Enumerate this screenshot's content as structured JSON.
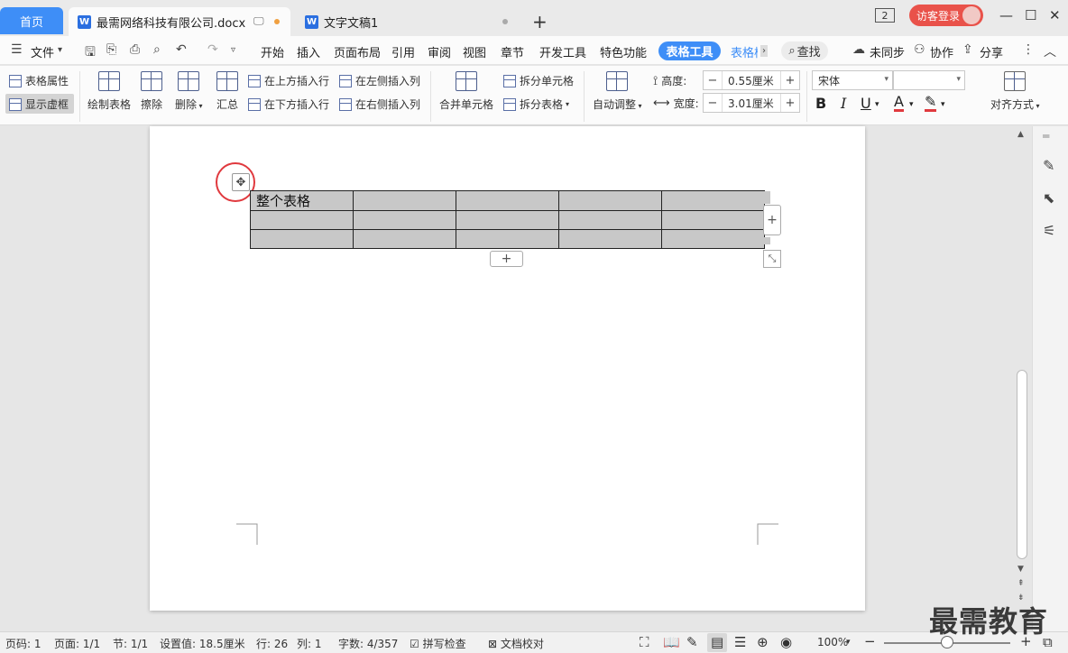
{
  "titlebar": {
    "home_tab": "首页",
    "tabs": [
      {
        "label": "最需网络科技有限公司.docx",
        "icon": "W"
      },
      {
        "label": "文字文稿1",
        "icon": "W"
      }
    ],
    "new_tab": "+",
    "page_count_badge": "2",
    "login_label": "访客登录",
    "window_controls": [
      "—",
      "☐",
      "✕"
    ]
  },
  "menubar": {
    "file_label": "文件",
    "menus": [
      "开始",
      "插入",
      "页面布局",
      "引用",
      "审阅",
      "视图",
      "章节",
      "开发工具",
      "特色功能"
    ],
    "active_tab": "表格工具",
    "next_tab": "表格样式",
    "search_label": "查找",
    "sync_label": "未同步",
    "collab_label": "协作",
    "share_label": "分享"
  },
  "ribbon": {
    "table_props": "表格属性",
    "show_gridlines": "显示虚框",
    "draw_table": "绘制表格",
    "eraser": "擦除",
    "delete": "删除",
    "summary": "汇总",
    "insert_row_above": "在上方插入行",
    "insert_row_below": "在下方插入行",
    "insert_col_left": "在左侧插入列",
    "insert_col_right": "在右侧插入列",
    "merge_cells": "合并单元格",
    "split_cells": "拆分单元格",
    "split_table": "拆分表格",
    "auto_fit": "自动调整",
    "height_label": "高度:",
    "height_value": "0.55厘米",
    "width_label": "宽度:",
    "width_value": "3.01厘米",
    "font_name": "宋体",
    "font_size": "",
    "align_label": "对齐方式"
  },
  "document": {
    "table": {
      "rows": [
        [
          "整个表格",
          "",
          "",
          "",
          ""
        ],
        [
          "",
          "",
          "",
          "",
          ""
        ],
        [
          "",
          "",
          "",
          "",
          ""
        ]
      ]
    }
  },
  "statusbar": {
    "page_num": "页码: 1",
    "pages": "页面: 1/1",
    "section": "节: 1/1",
    "setting": "设置值: 18.5厘米",
    "row": "行: 26",
    "col": "列: 1",
    "wordcount": "字数: 4/357",
    "spellcheck": "拼写检查",
    "doc_check": "文档校对",
    "zoom": "100%"
  },
  "watermark": "最需教育",
  "colors": {
    "accent": "#3e8ef7",
    "login": "#e9524a",
    "highlight_circle": "#e0393e",
    "cell_fill": "#c8c8c8"
  }
}
